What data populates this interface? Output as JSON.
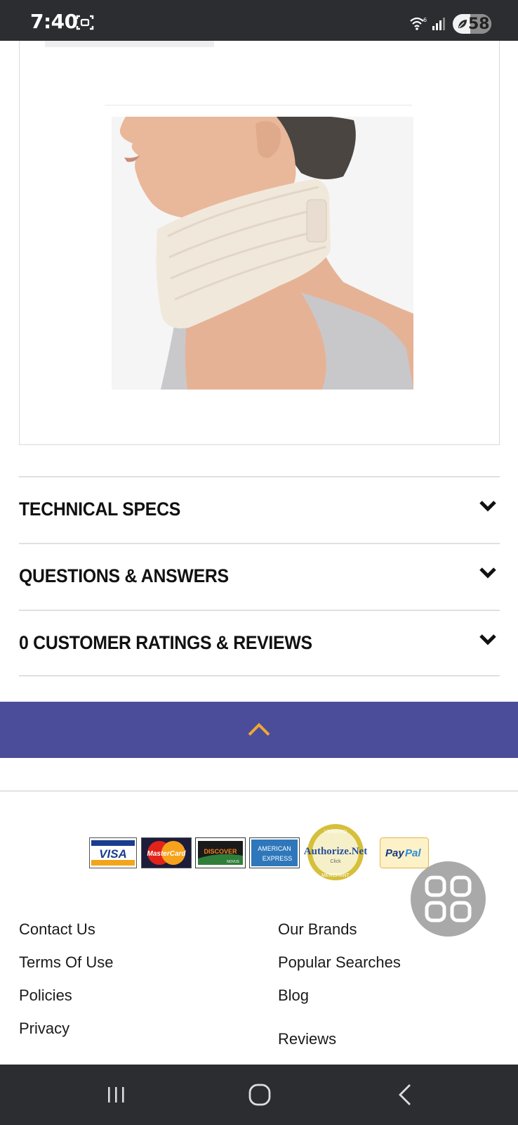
{
  "status_bar": {
    "time": "7:40",
    "battery": "58",
    "icons": [
      "screenshot-icon",
      "wifi-6-icon",
      "signal-icon",
      "battery-saver-icon"
    ]
  },
  "product": {
    "image_alt": "Foam cervical neck collar worn by a woman"
  },
  "accordion": [
    {
      "label": "TECHNICAL SPECS"
    },
    {
      "label": "QUESTIONS & ANSWERS"
    },
    {
      "label": "0 CUSTOMER RATINGS & REVIEWS"
    }
  ],
  "colors": {
    "band": "#4b4d9b",
    "arrow": "#f0a830",
    "status_bar": "#2b2d31"
  },
  "payments": {
    "visa": "VISA",
    "mastercard": "MasterCard",
    "discover": "DISCOVER",
    "discover_sub": "NOVUS",
    "amex_top": "AMERICAN",
    "amex_bottom": "EXPRESS",
    "authorize": "Authorize.Net",
    "authorize_click": "Click",
    "authorize_ring_top": "VERIFIED",
    "authorize_ring_bottom": "MERCHANT",
    "paypal_pay": "Pay",
    "paypal_pal": "Pal"
  },
  "footer": {
    "left_links": [
      "Contact Us",
      "Terms Of Use",
      "Policies",
      "Privacy"
    ],
    "right_links": [
      "Our Brands",
      "Popular Searches",
      "Blog",
      "Reviews"
    ]
  }
}
